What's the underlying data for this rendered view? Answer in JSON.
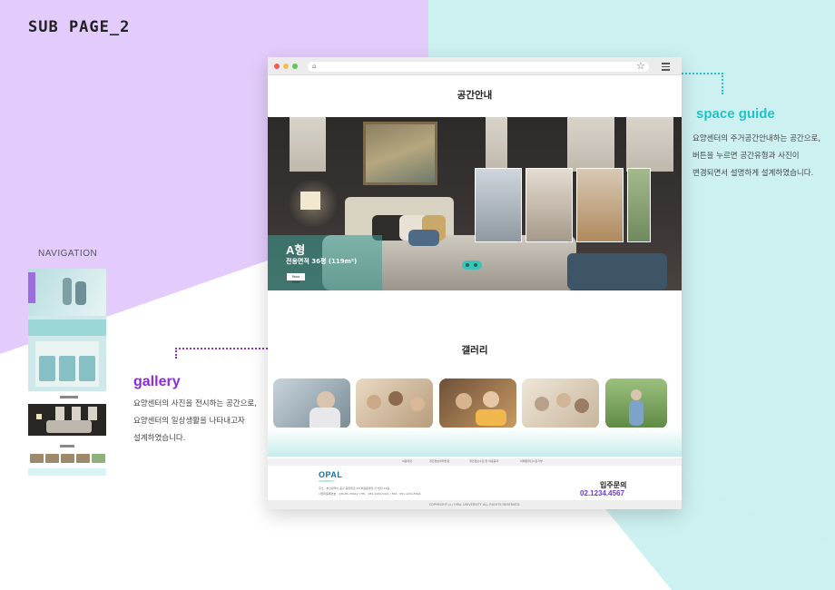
{
  "page_label": "SUB PAGE_2",
  "colors": {
    "lavender": "#E3CCFB",
    "mint": "#CDF1F1",
    "gallery_accent": "#8A2BE2",
    "guide_accent": "#20C4C8",
    "phone_accent": "#6A3FD0"
  },
  "navigation": {
    "title": "NAVIGATION"
  },
  "annotations": {
    "space_guide": {
      "heading": "space guide",
      "lines": [
        "요양센터의 주거공간안내하는 공간으로,",
        "버튼을 누르면 공간유형과 사진이",
        "변경되면서 설명하게 설계하였습니다."
      ]
    },
    "gallery": {
      "heading": "gallery",
      "lines": [
        "요양센터의 사진을 전시하는 공간으로,",
        "요양센터의 일상생활을 나타내고자",
        "설계하였습니다."
      ]
    }
  },
  "browser": {
    "icons": [
      "lock-icon",
      "star-icon",
      "menu-icon"
    ],
    "space_section": {
      "title": "공간안내",
      "room_name": "A형",
      "room_area": "전용면적 36평 (119m²)",
      "read_more": "Read More"
    },
    "gallery_section": {
      "title": "갤러리"
    },
    "footer": {
      "links": [
        "이용약관",
        "개인정보처리방침",
        "개인정보수집 및 이용동의",
        "이메일무단수집거부"
      ],
      "logo": "OPAL",
      "logo_sub": "UNIVERSITY",
      "address_line1": "주소 : 부산광역시 중구 중앙대로 26 부원동빌딩 ⑪ 빌딩 12층",
      "address_line2": "사업자등록번호 : 130-81-33412 | TEL : 051-1234-5411 | FAX : 051-1234-5544",
      "inquiry_label": "입주문의",
      "inquiry_phone": "02.1234.4567",
      "copyright": "COPYRIGHT (c) OPAL UNIVERSITY ALL RIGHTS RESERVED."
    }
  }
}
